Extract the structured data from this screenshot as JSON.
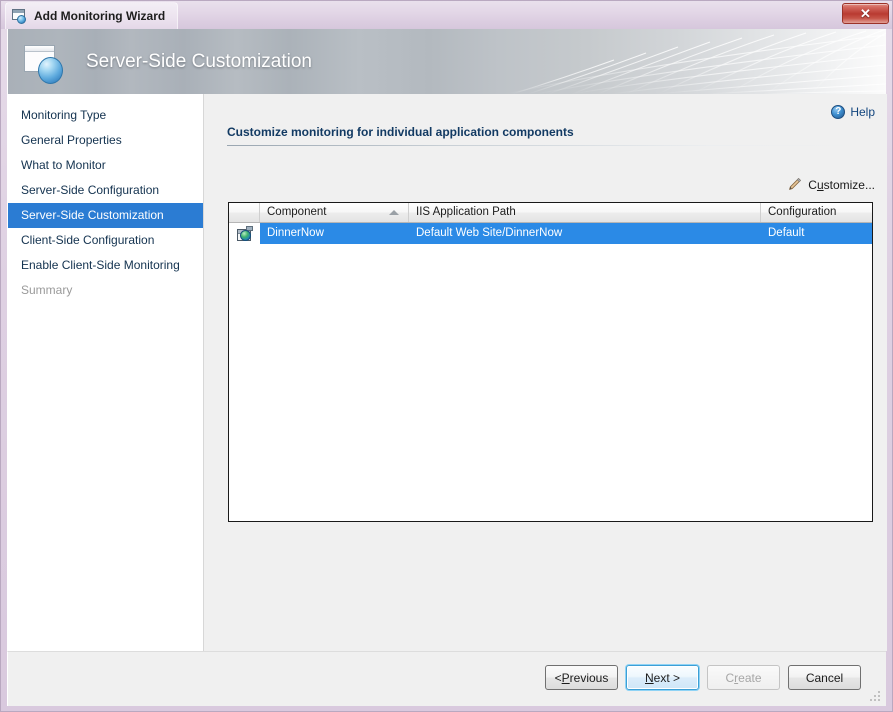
{
  "window": {
    "title": "Add Monitoring Wizard",
    "app_icon": "window-sphere-icon",
    "close_label": "✕"
  },
  "banner": {
    "title": "Server-Side Customization",
    "icon": "window-sphere-icon"
  },
  "sidebar": {
    "items": [
      {
        "label": "Monitoring Type",
        "state": "normal"
      },
      {
        "label": "General Properties",
        "state": "normal"
      },
      {
        "label": "What to Monitor",
        "state": "normal"
      },
      {
        "label": "Server-Side Configuration",
        "state": "normal"
      },
      {
        "label": "Server-Side Customization",
        "state": "selected"
      },
      {
        "label": "Client-Side Configuration",
        "state": "normal"
      },
      {
        "label": "Enable Client-Side Monitoring",
        "state": "normal"
      },
      {
        "label": "Summary",
        "state": "disabled"
      }
    ],
    "selected_index": 4
  },
  "main": {
    "help": {
      "label": "Help",
      "icon": "question-mark-icon"
    },
    "section_title": "Customize monitoring for individual application components",
    "customize": {
      "label_pre": "C",
      "label_accel": "u",
      "label_post": "stomize...",
      "icon": "pencil-icon"
    },
    "table": {
      "columns": [
        {
          "key": "icon",
          "label": ""
        },
        {
          "key": "component",
          "label": "Component",
          "sorted": "asc"
        },
        {
          "key": "path",
          "label": "IIS Application Path"
        },
        {
          "key": "configuration",
          "label": "Configuration"
        }
      ],
      "rows": [
        {
          "icon": "web-application-icon",
          "component": "DinnerNow",
          "path": "Default Web Site/DinnerNow",
          "configuration": "Default",
          "selected": true
        }
      ]
    }
  },
  "footer": {
    "buttons": [
      {
        "name": "previous",
        "pre": "< ",
        "accel": "P",
        "post": "revious",
        "state": "normal"
      },
      {
        "name": "next",
        "pre": "",
        "accel": "N",
        "post": "ext >",
        "state": "focused"
      },
      {
        "name": "create",
        "pre": "C",
        "accel": "r",
        "post": "eate",
        "state": "disabled"
      },
      {
        "name": "cancel",
        "pre": "",
        "accel": "C",
        "post": "ancel",
        "state": "normal",
        "no_underline": true
      }
    ]
  },
  "colors": {
    "selection_blue": "#2b8ae6",
    "nav_selected_blue": "#2b7cd3",
    "link_blue": "#12457e",
    "title_purple": "#e2d5e6",
    "close_red": "#b93a31"
  }
}
